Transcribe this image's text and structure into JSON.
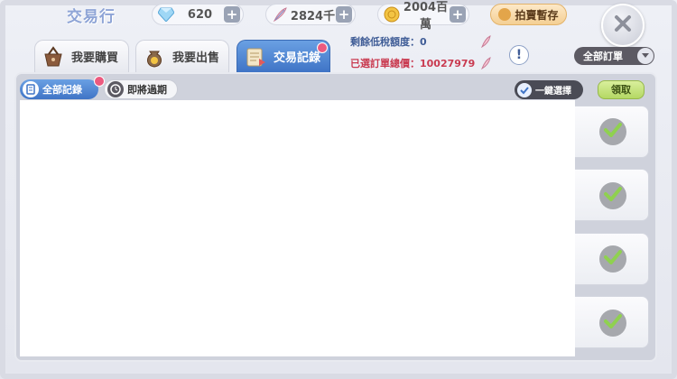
{
  "header": {
    "title": "交易行",
    "diamond": {
      "value": "620",
      "icon": "diamond-icon"
    },
    "feather": {
      "value": "2824千",
      "icon": "feather-icon"
    },
    "coin": {
      "value": "2004百萬",
      "icon": "coin-icon"
    },
    "auction_label": "拍賣暫存"
  },
  "tabs": [
    {
      "label": "我要購買",
      "icon": "basket-icon"
    },
    {
      "label": "我要出售",
      "icon": "money-bag-icon"
    },
    {
      "label": "交易記錄",
      "icon": "records-icon"
    }
  ],
  "info": {
    "tax_label": "剩餘低稅額度：",
    "tax_value": "0",
    "total_label": "已選訂單總價：",
    "total_value": "10027979",
    "info_button": "!"
  },
  "filter": {
    "selected": "全部訂單"
  },
  "subtabs": [
    {
      "label": "全部記錄",
      "icon": "document-icon"
    },
    {
      "label": "即將過期",
      "icon": "clock-icon"
    }
  ],
  "actions": {
    "select_all": "一鍵選擇",
    "claim": "領取"
  },
  "colors": {
    "accent_blue": "#3f74c6",
    "red_text": "#c93a50",
    "claim_green": "#b4d863",
    "badge_pink": "#ec5a7f"
  }
}
